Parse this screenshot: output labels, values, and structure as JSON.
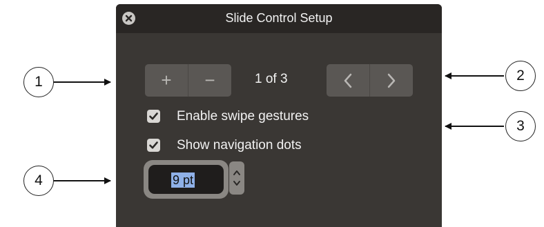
{
  "dialog": {
    "title": "Slide Control Setup",
    "close_icon": "close-icon"
  },
  "slide_controls": {
    "add_label": "+",
    "remove_label": "−",
    "counter": "1 of 3",
    "prev_icon": "chevron-left-icon",
    "next_icon": "chevron-right-icon"
  },
  "options": [
    {
      "label": "Enable swipe gestures",
      "checked": true
    },
    {
      "label": "Show navigation dots",
      "checked": true
    }
  ],
  "dot_size": {
    "value": "9 pt",
    "stepper_icon": "up-down-stepper-icon"
  },
  "callouts": [
    "1",
    "2",
    "3",
    "4"
  ],
  "colors": {
    "panel": "#3a3734",
    "titlebar": "#292624",
    "selection": "#8fb1e8"
  }
}
